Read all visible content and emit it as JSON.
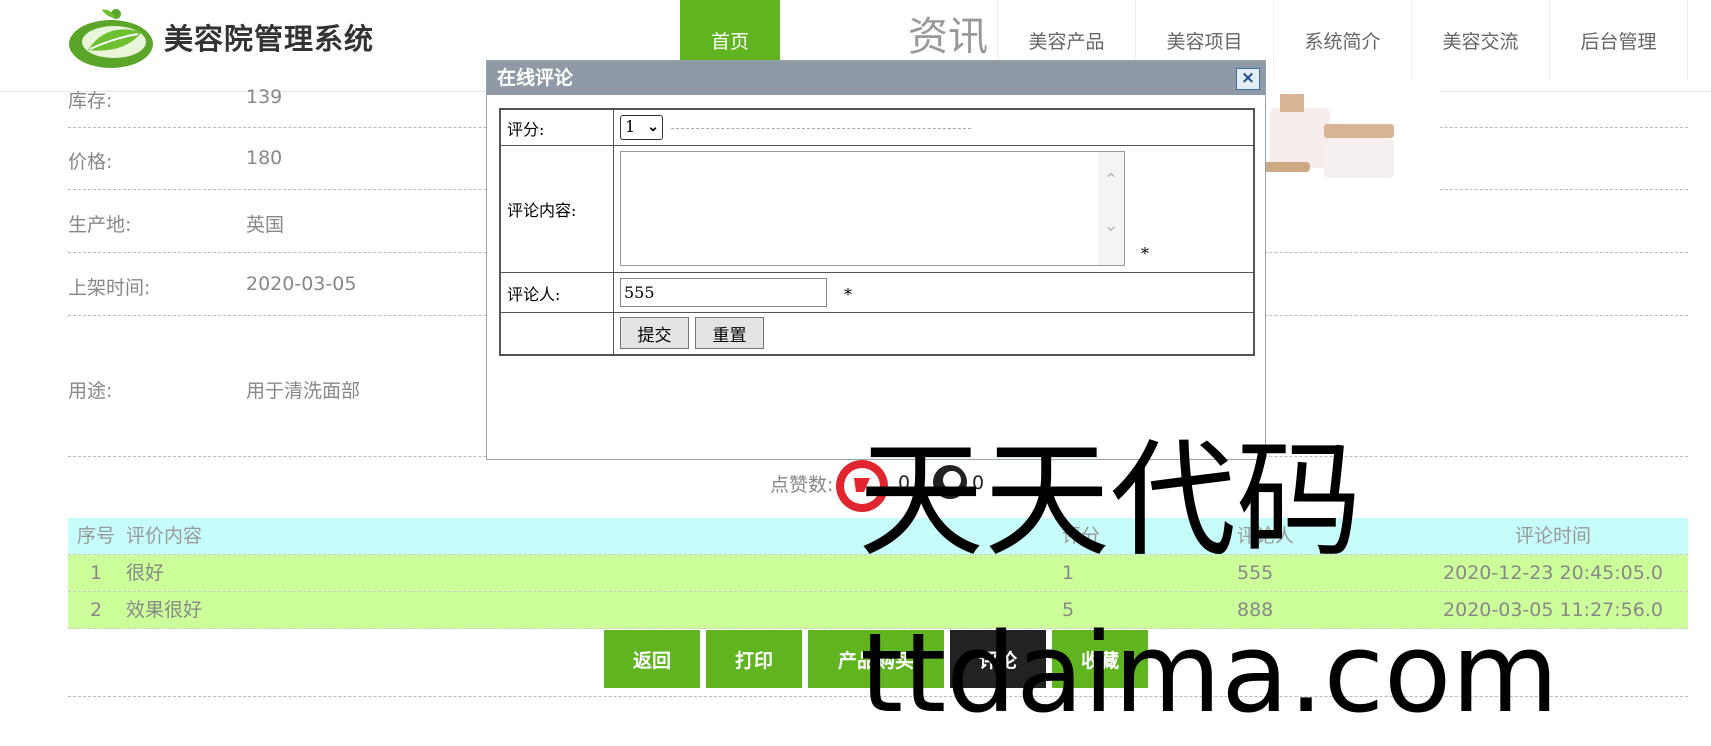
{
  "header": {
    "site_title": "美容院管理系统",
    "nav": [
      {
        "label": "首页",
        "active": true
      },
      {
        "label": "美容资讯"
      },
      {
        "label": "美容产品"
      },
      {
        "label": "美容项目"
      },
      {
        "label": "系统简介"
      },
      {
        "label": "美容交流"
      },
      {
        "label": "后台管理"
      }
    ]
  },
  "detail": {
    "stock_label": "库存:",
    "stock_value": "139",
    "price_label": "价格:",
    "price_value": "180",
    "origin_label": "生产地:",
    "origin_value": "英国",
    "date_label": "上架时间:",
    "date_value": "2020-03-05",
    "usage_label": "用途:",
    "usage_value": "用于清洗面部"
  },
  "likes": {
    "label": "点赞数:",
    "up": "0",
    "down": "0"
  },
  "comments": {
    "headers": {
      "no": "序号",
      "content": "评价内容",
      "score": "评分",
      "user": "评论人",
      "time": "评论时间"
    },
    "rows": [
      {
        "no": "1",
        "content": "很好",
        "score": "1",
        "user": "555",
        "time": "2020-12-23 20:45:05.0"
      },
      {
        "no": "2",
        "content": "效果很好",
        "score": "5",
        "user": "888",
        "time": "2020-03-05 11:27:56.0"
      }
    ]
  },
  "actions": {
    "back": "返回",
    "print": "打印",
    "buy": "产品购买",
    "comment": "评论",
    "favorite": "收藏"
  },
  "dialog": {
    "title": "在线评论",
    "close": "×",
    "score_label": "评分:",
    "score_value": "1",
    "content_label": "评论内容:",
    "content_value": "",
    "commenter_label": "评论人:",
    "commenter_value": "555",
    "required_mark": "*",
    "submit": "提交",
    "reset": "重置"
  },
  "watermark": {
    "line1": "天天代码",
    "line2": "ttdaima.com"
  },
  "colors": {
    "primary_green": "#5fb41f",
    "header_row": "#c6fcf9",
    "data_row": "#ccff99",
    "dialog_title": "#8e9ba6"
  }
}
